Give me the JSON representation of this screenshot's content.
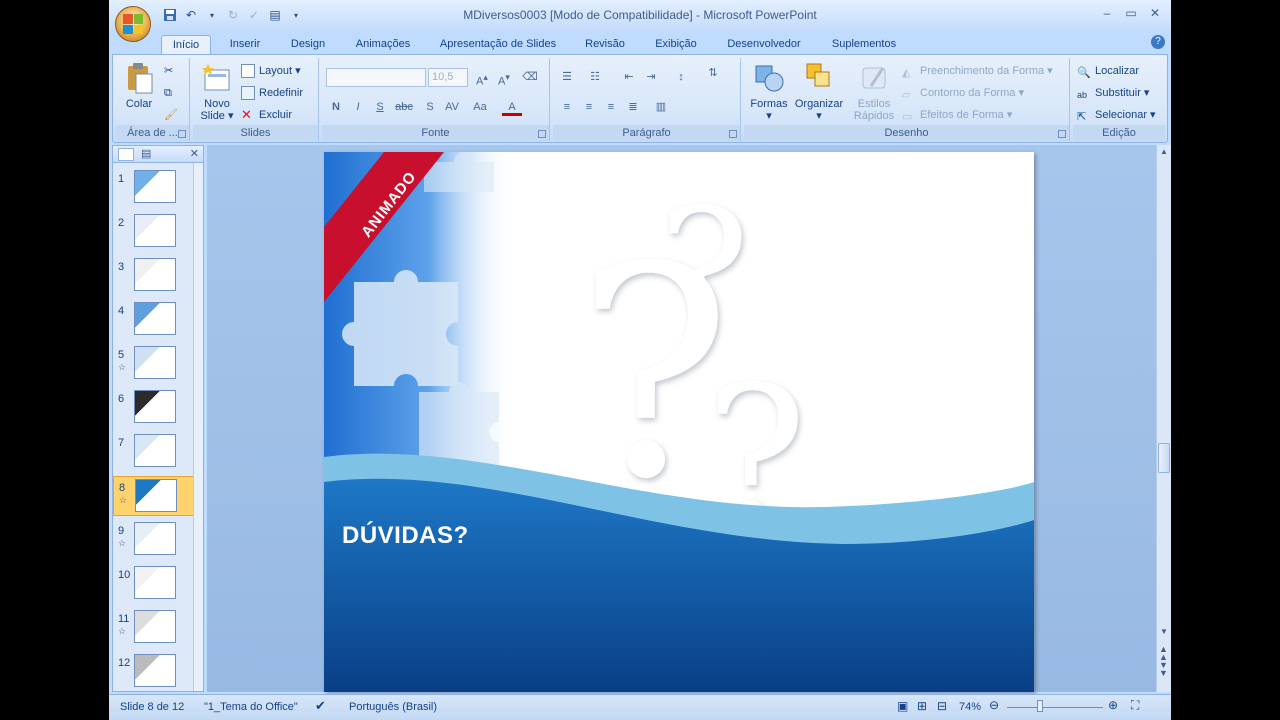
{
  "window": {
    "title": "MDiversos0003 [Modo de Compatibilidade] - Microsoft PowerPoint",
    "controls": {
      "minimize": "–",
      "maximize": "▭",
      "close": "✕"
    }
  },
  "tabs": [
    "Início",
    "Inserir",
    "Design",
    "Animações",
    "Apresentação de Slides",
    "Revisão",
    "Exibição",
    "Desenvolvedor",
    "Suplementos"
  ],
  "ribbon": {
    "clipboard": {
      "label": "Área de ...",
      "paste": "Colar"
    },
    "slides": {
      "label": "Slides",
      "new_slide_1": "Novo",
      "new_slide_2": "Slide",
      "layout": "Layout",
      "reset": "Redefinir",
      "delete": "Excluir"
    },
    "font": {
      "label": "Fonte",
      "font_name": "",
      "font_size": "10,5",
      "bold": "N",
      "italic": "I",
      "underline": "S",
      "strike": "abc",
      "shadow": "S"
    },
    "paragraph": {
      "label": "Parágrafo"
    },
    "drawing": {
      "label": "Desenho",
      "shapes": "Formas",
      "arrange": "Organizar",
      "quick_styles_1": "Estilos",
      "quick_styles_2": "Rápidos",
      "fill": "Preenchimento da Forma",
      "outline": "Contorno da Forma",
      "effects": "Efeitos de Forma"
    },
    "editing": {
      "label": "Edição",
      "find": "Localizar",
      "replace": "Substituir",
      "select": "Selecionar"
    }
  },
  "thumbnails": [
    {
      "num": "1",
      "star": ""
    },
    {
      "num": "2",
      "star": ""
    },
    {
      "num": "3",
      "star": ""
    },
    {
      "num": "4",
      "star": ""
    },
    {
      "num": "5",
      "star": "☆"
    },
    {
      "num": "6",
      "star": ""
    },
    {
      "num": "7",
      "star": ""
    },
    {
      "num": "8",
      "star": "☆"
    },
    {
      "num": "9",
      "star": "☆"
    },
    {
      "num": "10",
      "star": ""
    },
    {
      "num": "11",
      "star": "☆"
    },
    {
      "num": "12",
      "star": ""
    }
  ],
  "slide": {
    "ribbon_text": "ANIMADO",
    "heading": "DÚVIDAS?"
  },
  "status": {
    "slide_info": "Slide 8 de 12",
    "theme": "\"1_Tema do Office\"",
    "language": "Português (Brasil)",
    "zoom": "74%"
  },
  "colors": {
    "accent": "#15428b",
    "ribbon_red": "#c8102e",
    "slide_blue": "#1a6fbf"
  }
}
